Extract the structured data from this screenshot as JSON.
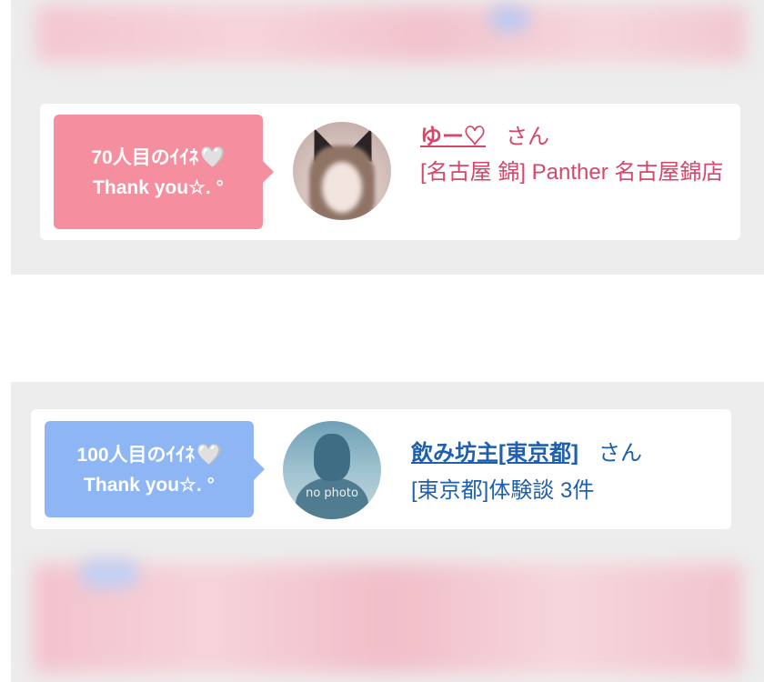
{
  "likes": [
    {
      "count_text": "70人目のｲｲﾈ",
      "heart": "🤍",
      "thanks": "Thank you☆. °",
      "user_name": "ゆー♡",
      "honorific": "さん",
      "detail": "[名古屋 錦] Panther 名古屋錦店",
      "theme_color": "#f58f9f",
      "text_color": "#d8466a"
    },
    {
      "count_text": "100人目のｲｲﾈ",
      "heart": "🤍",
      "thanks": "Thank you☆. °",
      "user_name": "飲み坊主[東京都]",
      "honorific": "さん",
      "detail": "[東京都]体験談 3件",
      "avatar_text": "no photo",
      "theme_color": "#8eb6f5",
      "text_color": "#1e5fb0"
    }
  ]
}
